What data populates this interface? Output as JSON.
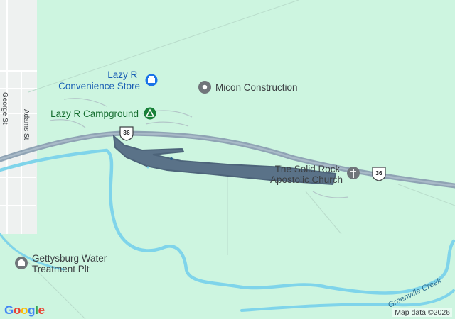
{
  "map": {
    "pois": [
      {
        "id": "lazy-r-store",
        "lines": [
          "Lazy R",
          "Convenience Store"
        ],
        "icon": "shopping-icon",
        "color": "#1a73e8",
        "text_color": "#1a5fb4"
      },
      {
        "id": "micon",
        "lines": [
          "Micon Construction"
        ],
        "icon": "pin-icon",
        "color": "#70757a",
        "text_color": "#3c4043"
      },
      {
        "id": "campground",
        "lines": [
          "Lazy R Campground"
        ],
        "icon": "campground-icon",
        "color": "#188038",
        "text_color": "#146c2e"
      },
      {
        "id": "church",
        "lines": [
          "The Solid Rock",
          "Apostolic Church"
        ],
        "icon": "church-icon",
        "color": "#70757a",
        "text_color": "#3c4043"
      },
      {
        "id": "water-plant",
        "lines": [
          "Gettysburg Water",
          "Treatment Plt"
        ],
        "icon": "facility-icon",
        "color": "#70757a",
        "text_color": "#3c4043"
      }
    ],
    "streets": [
      {
        "id": "george",
        "label": "George St"
      },
      {
        "id": "adams",
        "label": "Adams St"
      }
    ],
    "route_shields": [
      {
        "id": "us36-west",
        "label": "36"
      },
      {
        "id": "us36-east",
        "label": "36"
      }
    ],
    "creek_label": "Greenville Creek"
  },
  "footer": {
    "logo_letters": [
      "G",
      "o",
      "o",
      "g",
      "l",
      "e"
    ],
    "logo_colors": [
      "#4285f4",
      "#ea4335",
      "#fbbc05",
      "#4285f4",
      "#34a853",
      "#ea4335"
    ],
    "attribution": "Map data ©2026"
  },
  "colors": {
    "land": "#cdf5e0",
    "water": "#7fd4ea",
    "highway": "#8fa3b4",
    "highlight": "#5a7288",
    "town": "#eef1f0"
  }
}
